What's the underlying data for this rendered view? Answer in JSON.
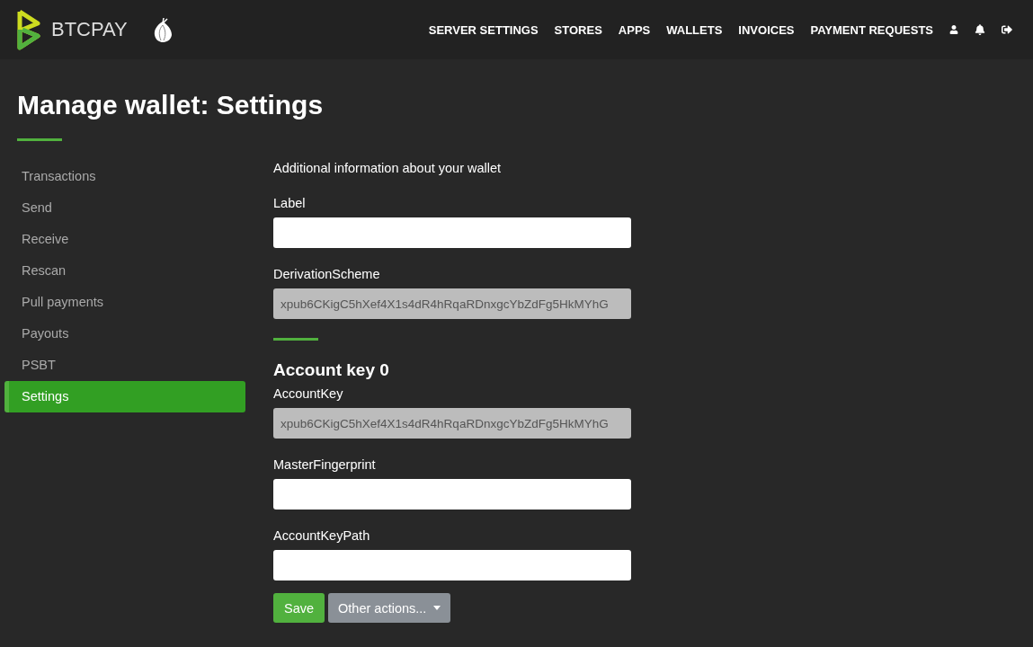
{
  "header": {
    "logo_text": "BTCPAY",
    "nav": [
      {
        "label": "SERVER SETTINGS"
      },
      {
        "label": "STORES"
      },
      {
        "label": "APPS"
      },
      {
        "label": "WALLETS"
      },
      {
        "label": "INVOICES"
      },
      {
        "label": "PAYMENT REQUESTS"
      }
    ]
  },
  "page_title": "Manage wallet: Settings",
  "sidebar": {
    "items": [
      {
        "label": "Transactions",
        "selected": false
      },
      {
        "label": "Send",
        "selected": false
      },
      {
        "label": "Receive",
        "selected": false
      },
      {
        "label": "Rescan",
        "selected": false
      },
      {
        "label": "Pull payments",
        "selected": false
      },
      {
        "label": "Payouts",
        "selected": false
      },
      {
        "label": "PSBT",
        "selected": false
      },
      {
        "label": "Settings",
        "selected": true
      }
    ]
  },
  "intro": "Additional information about your wallet",
  "fields": [
    {
      "label": "Label",
      "disabled": false
    },
    {
      "label": "DerivationScheme",
      "value": "xpub6CKigC5hXef4X1s4dR4hRqaRDnxgcYbZdFg5HkMYhG",
      "disabled": true
    }
  ],
  "account_section": {
    "title": "Account key 0",
    "fields": [
      {
        "label": "AccountKey",
        "value": "xpub6CKigC5hXef4X1s4dR4hRqaRDnxgcYbZdFg5HkMYhG",
        "disabled": true
      },
      {
        "label": "MasterFingerprint",
        "disabled": false
      },
      {
        "label": "AccountKeyPath",
        "disabled": false
      }
    ]
  },
  "buttons": {
    "save": "Save",
    "other": "Other actions..."
  }
}
